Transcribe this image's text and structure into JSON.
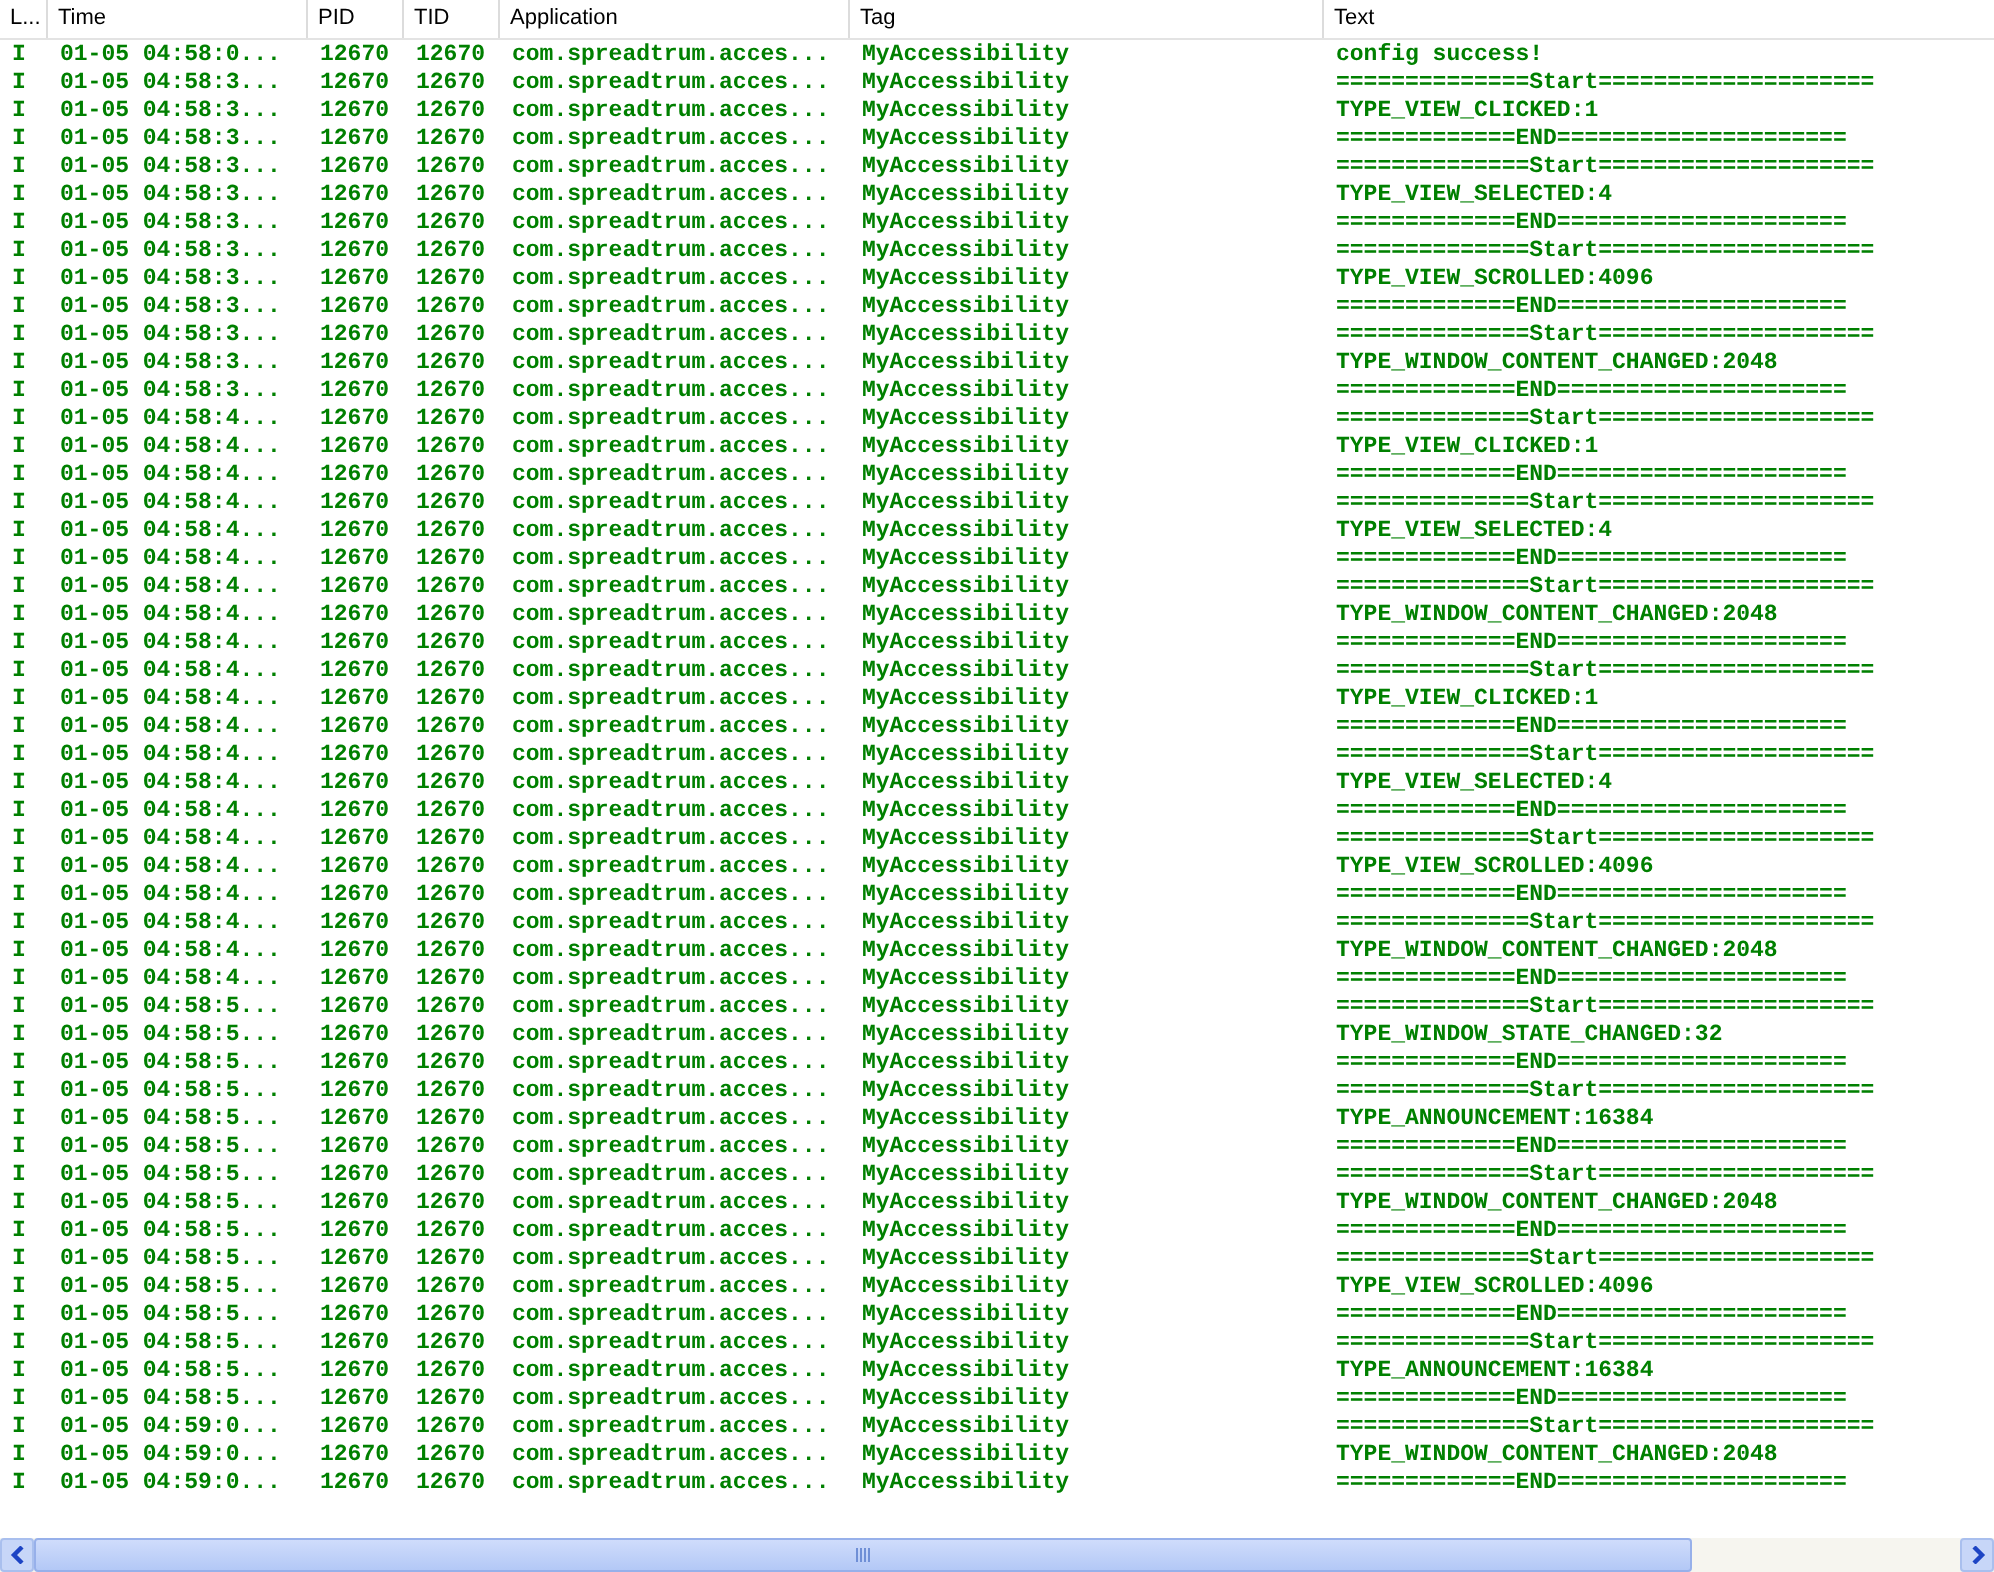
{
  "table": {
    "columns": [
      {
        "label": "L..."
      },
      {
        "label": "Time"
      },
      {
        "label": "PID"
      },
      {
        "label": "TID"
      },
      {
        "label": "Application"
      },
      {
        "label": "Tag"
      },
      {
        "label": "Text"
      }
    ],
    "rows": [
      {
        "level": "I",
        "time": "01-05 04:58:0...",
        "pid": "12670",
        "tid": "12670",
        "application": "com.spreadtrum.acces...",
        "tag": "MyAccessibility",
        "text": "config success!"
      },
      {
        "level": "I",
        "time": "01-05 04:58:3...",
        "pid": "12670",
        "tid": "12670",
        "application": "com.spreadtrum.acces...",
        "tag": "MyAccessibility",
        "text": "==============Start===================="
      },
      {
        "level": "I",
        "time": "01-05 04:58:3...",
        "pid": "12670",
        "tid": "12670",
        "application": "com.spreadtrum.acces...",
        "tag": "MyAccessibility",
        "text": "TYPE_VIEW_CLICKED:1"
      },
      {
        "level": "I",
        "time": "01-05 04:58:3...",
        "pid": "12670",
        "tid": "12670",
        "application": "com.spreadtrum.acces...",
        "tag": "MyAccessibility",
        "text": "=============END====================="
      },
      {
        "level": "I",
        "time": "01-05 04:58:3...",
        "pid": "12670",
        "tid": "12670",
        "application": "com.spreadtrum.acces...",
        "tag": "MyAccessibility",
        "text": "==============Start===================="
      },
      {
        "level": "I",
        "time": "01-05 04:58:3...",
        "pid": "12670",
        "tid": "12670",
        "application": "com.spreadtrum.acces...",
        "tag": "MyAccessibility",
        "text": "TYPE_VIEW_SELECTED:4"
      },
      {
        "level": "I",
        "time": "01-05 04:58:3...",
        "pid": "12670",
        "tid": "12670",
        "application": "com.spreadtrum.acces...",
        "tag": "MyAccessibility",
        "text": "=============END====================="
      },
      {
        "level": "I",
        "time": "01-05 04:58:3...",
        "pid": "12670",
        "tid": "12670",
        "application": "com.spreadtrum.acces...",
        "tag": "MyAccessibility",
        "text": "==============Start===================="
      },
      {
        "level": "I",
        "time": "01-05 04:58:3...",
        "pid": "12670",
        "tid": "12670",
        "application": "com.spreadtrum.acces...",
        "tag": "MyAccessibility",
        "text": "TYPE_VIEW_SCROLLED:4096"
      },
      {
        "level": "I",
        "time": "01-05 04:58:3...",
        "pid": "12670",
        "tid": "12670",
        "application": "com.spreadtrum.acces...",
        "tag": "MyAccessibility",
        "text": "=============END====================="
      },
      {
        "level": "I",
        "time": "01-05 04:58:3...",
        "pid": "12670",
        "tid": "12670",
        "application": "com.spreadtrum.acces...",
        "tag": "MyAccessibility",
        "text": "==============Start===================="
      },
      {
        "level": "I",
        "time": "01-05 04:58:3...",
        "pid": "12670",
        "tid": "12670",
        "application": "com.spreadtrum.acces...",
        "tag": "MyAccessibility",
        "text": "TYPE_WINDOW_CONTENT_CHANGED:2048"
      },
      {
        "level": "I",
        "time": "01-05 04:58:3...",
        "pid": "12670",
        "tid": "12670",
        "application": "com.spreadtrum.acces...",
        "tag": "MyAccessibility",
        "text": "=============END====================="
      },
      {
        "level": "I",
        "time": "01-05 04:58:4...",
        "pid": "12670",
        "tid": "12670",
        "application": "com.spreadtrum.acces...",
        "tag": "MyAccessibility",
        "text": "==============Start===================="
      },
      {
        "level": "I",
        "time": "01-05 04:58:4...",
        "pid": "12670",
        "tid": "12670",
        "application": "com.spreadtrum.acces...",
        "tag": "MyAccessibility",
        "text": "TYPE_VIEW_CLICKED:1"
      },
      {
        "level": "I",
        "time": "01-05 04:58:4...",
        "pid": "12670",
        "tid": "12670",
        "application": "com.spreadtrum.acces...",
        "tag": "MyAccessibility",
        "text": "=============END====================="
      },
      {
        "level": "I",
        "time": "01-05 04:58:4...",
        "pid": "12670",
        "tid": "12670",
        "application": "com.spreadtrum.acces...",
        "tag": "MyAccessibility",
        "text": "==============Start===================="
      },
      {
        "level": "I",
        "time": "01-05 04:58:4...",
        "pid": "12670",
        "tid": "12670",
        "application": "com.spreadtrum.acces...",
        "tag": "MyAccessibility",
        "text": "TYPE_VIEW_SELECTED:4"
      },
      {
        "level": "I",
        "time": "01-05 04:58:4...",
        "pid": "12670",
        "tid": "12670",
        "application": "com.spreadtrum.acces...",
        "tag": "MyAccessibility",
        "text": "=============END====================="
      },
      {
        "level": "I",
        "time": "01-05 04:58:4...",
        "pid": "12670",
        "tid": "12670",
        "application": "com.spreadtrum.acces...",
        "tag": "MyAccessibility",
        "text": "==============Start===================="
      },
      {
        "level": "I",
        "time": "01-05 04:58:4...",
        "pid": "12670",
        "tid": "12670",
        "application": "com.spreadtrum.acces...",
        "tag": "MyAccessibility",
        "text": "TYPE_WINDOW_CONTENT_CHANGED:2048"
      },
      {
        "level": "I",
        "time": "01-05 04:58:4...",
        "pid": "12670",
        "tid": "12670",
        "application": "com.spreadtrum.acces...",
        "tag": "MyAccessibility",
        "text": "=============END====================="
      },
      {
        "level": "I",
        "time": "01-05 04:58:4...",
        "pid": "12670",
        "tid": "12670",
        "application": "com.spreadtrum.acces...",
        "tag": "MyAccessibility",
        "text": "==============Start===================="
      },
      {
        "level": "I",
        "time": "01-05 04:58:4...",
        "pid": "12670",
        "tid": "12670",
        "application": "com.spreadtrum.acces...",
        "tag": "MyAccessibility",
        "text": "TYPE_VIEW_CLICKED:1"
      },
      {
        "level": "I",
        "time": "01-05 04:58:4...",
        "pid": "12670",
        "tid": "12670",
        "application": "com.spreadtrum.acces...",
        "tag": "MyAccessibility",
        "text": "=============END====================="
      },
      {
        "level": "I",
        "time": "01-05 04:58:4...",
        "pid": "12670",
        "tid": "12670",
        "application": "com.spreadtrum.acces...",
        "tag": "MyAccessibility",
        "text": "==============Start===================="
      },
      {
        "level": "I",
        "time": "01-05 04:58:4...",
        "pid": "12670",
        "tid": "12670",
        "application": "com.spreadtrum.acces...",
        "tag": "MyAccessibility",
        "text": "TYPE_VIEW_SELECTED:4"
      },
      {
        "level": "I",
        "time": "01-05 04:58:4...",
        "pid": "12670",
        "tid": "12670",
        "application": "com.spreadtrum.acces...",
        "tag": "MyAccessibility",
        "text": "=============END====================="
      },
      {
        "level": "I",
        "time": "01-05 04:58:4...",
        "pid": "12670",
        "tid": "12670",
        "application": "com.spreadtrum.acces...",
        "tag": "MyAccessibility",
        "text": "==============Start===================="
      },
      {
        "level": "I",
        "time": "01-05 04:58:4...",
        "pid": "12670",
        "tid": "12670",
        "application": "com.spreadtrum.acces...",
        "tag": "MyAccessibility",
        "text": "TYPE_VIEW_SCROLLED:4096"
      },
      {
        "level": "I",
        "time": "01-05 04:58:4...",
        "pid": "12670",
        "tid": "12670",
        "application": "com.spreadtrum.acces...",
        "tag": "MyAccessibility",
        "text": "=============END====================="
      },
      {
        "level": "I",
        "time": "01-05 04:58:4...",
        "pid": "12670",
        "tid": "12670",
        "application": "com.spreadtrum.acces...",
        "tag": "MyAccessibility",
        "text": "==============Start===================="
      },
      {
        "level": "I",
        "time": "01-05 04:58:4...",
        "pid": "12670",
        "tid": "12670",
        "application": "com.spreadtrum.acces...",
        "tag": "MyAccessibility",
        "text": "TYPE_WINDOW_CONTENT_CHANGED:2048"
      },
      {
        "level": "I",
        "time": "01-05 04:58:4...",
        "pid": "12670",
        "tid": "12670",
        "application": "com.spreadtrum.acces...",
        "tag": "MyAccessibility",
        "text": "=============END====================="
      },
      {
        "level": "I",
        "time": "01-05 04:58:5...",
        "pid": "12670",
        "tid": "12670",
        "application": "com.spreadtrum.acces...",
        "tag": "MyAccessibility",
        "text": "==============Start===================="
      },
      {
        "level": "I",
        "time": "01-05 04:58:5...",
        "pid": "12670",
        "tid": "12670",
        "application": "com.spreadtrum.acces...",
        "tag": "MyAccessibility",
        "text": "TYPE_WINDOW_STATE_CHANGED:32"
      },
      {
        "level": "I",
        "time": "01-05 04:58:5...",
        "pid": "12670",
        "tid": "12670",
        "application": "com.spreadtrum.acces...",
        "tag": "MyAccessibility",
        "text": "=============END====================="
      },
      {
        "level": "I",
        "time": "01-05 04:58:5...",
        "pid": "12670",
        "tid": "12670",
        "application": "com.spreadtrum.acces...",
        "tag": "MyAccessibility",
        "text": "==============Start===================="
      },
      {
        "level": "I",
        "time": "01-05 04:58:5...",
        "pid": "12670",
        "tid": "12670",
        "application": "com.spreadtrum.acces...",
        "tag": "MyAccessibility",
        "text": "TYPE_ANNOUNCEMENT:16384"
      },
      {
        "level": "I",
        "time": "01-05 04:58:5...",
        "pid": "12670",
        "tid": "12670",
        "application": "com.spreadtrum.acces...",
        "tag": "MyAccessibility",
        "text": "=============END====================="
      },
      {
        "level": "I",
        "time": "01-05 04:58:5...",
        "pid": "12670",
        "tid": "12670",
        "application": "com.spreadtrum.acces...",
        "tag": "MyAccessibility",
        "text": "==============Start===================="
      },
      {
        "level": "I",
        "time": "01-05 04:58:5...",
        "pid": "12670",
        "tid": "12670",
        "application": "com.spreadtrum.acces...",
        "tag": "MyAccessibility",
        "text": "TYPE_WINDOW_CONTENT_CHANGED:2048"
      },
      {
        "level": "I",
        "time": "01-05 04:58:5...",
        "pid": "12670",
        "tid": "12670",
        "application": "com.spreadtrum.acces...",
        "tag": "MyAccessibility",
        "text": "=============END====================="
      },
      {
        "level": "I",
        "time": "01-05 04:58:5...",
        "pid": "12670",
        "tid": "12670",
        "application": "com.spreadtrum.acces...",
        "tag": "MyAccessibility",
        "text": "==============Start===================="
      },
      {
        "level": "I",
        "time": "01-05 04:58:5...",
        "pid": "12670",
        "tid": "12670",
        "application": "com.spreadtrum.acces...",
        "tag": "MyAccessibility",
        "text": "TYPE_VIEW_SCROLLED:4096"
      },
      {
        "level": "I",
        "time": "01-05 04:58:5...",
        "pid": "12670",
        "tid": "12670",
        "application": "com.spreadtrum.acces...",
        "tag": "MyAccessibility",
        "text": "=============END====================="
      },
      {
        "level": "I",
        "time": "01-05 04:58:5...",
        "pid": "12670",
        "tid": "12670",
        "application": "com.spreadtrum.acces...",
        "tag": "MyAccessibility",
        "text": "==============Start===================="
      },
      {
        "level": "I",
        "time": "01-05 04:58:5...",
        "pid": "12670",
        "tid": "12670",
        "application": "com.spreadtrum.acces...",
        "tag": "MyAccessibility",
        "text": "TYPE_ANNOUNCEMENT:16384"
      },
      {
        "level": "I",
        "time": "01-05 04:58:5...",
        "pid": "12670",
        "tid": "12670",
        "application": "com.spreadtrum.acces...",
        "tag": "MyAccessibility",
        "text": "=============END====================="
      },
      {
        "level": "I",
        "time": "01-05 04:59:0...",
        "pid": "12670",
        "tid": "12670",
        "application": "com.spreadtrum.acces...",
        "tag": "MyAccessibility",
        "text": "==============Start===================="
      },
      {
        "level": "I",
        "time": "01-05 04:59:0...",
        "pid": "12670",
        "tid": "12670",
        "application": "com.spreadtrum.acces...",
        "tag": "MyAccessibility",
        "text": "TYPE_WINDOW_CONTENT_CHANGED:2048"
      },
      {
        "level": "I",
        "time": "01-05 04:59:0...",
        "pid": "12670",
        "tid": "12670",
        "application": "com.spreadtrum.acces...",
        "tag": "MyAccessibility",
        "text": "=============END====================="
      }
    ]
  }
}
